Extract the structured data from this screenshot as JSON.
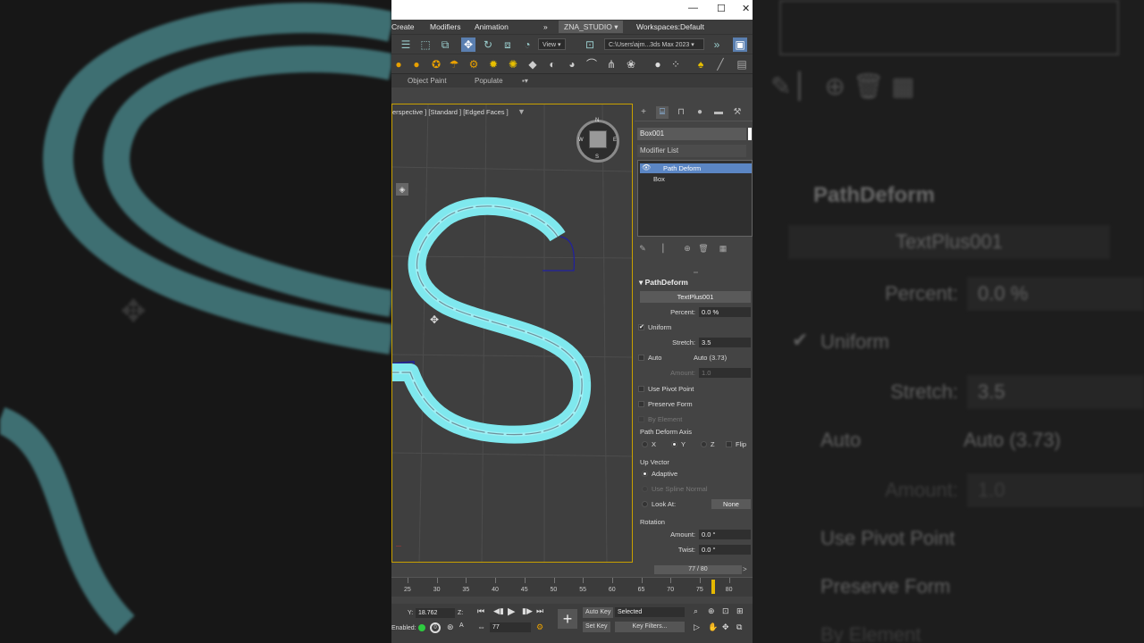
{
  "menubar": {
    "items": [
      "Create",
      "Modifiers",
      "Animation"
    ],
    "workspace_menu": "ZNA_STUDIO",
    "workspaces_label": "Workspaces:",
    "workspaces_value": "Default"
  },
  "toolbar": {
    "view_dropdown": "View",
    "path_dropdown": "C:\\Users\\ajm...3ds Max 2023"
  },
  "ribbon": {
    "tabs": [
      "Object Paint",
      "Populate"
    ]
  },
  "viewport": {
    "label": "erspective ] [Standard ] [Edged Faces ]",
    "compass": {
      "n": "N",
      "s": "S",
      "e": "E",
      "w": "W"
    }
  },
  "command_panel": {
    "object_name": "Box001",
    "modifier_list_label": "Modifier List",
    "stack": [
      "Path Deform",
      "Box"
    ],
    "rollout_title": "PathDeform",
    "path_button": "TextPlus001",
    "percent_label": "Percent:",
    "percent_value": "0.0 %",
    "uniform_label": "Uniform",
    "stretch_label": "Stretch:",
    "stretch_value": "3.5",
    "auto_label": "Auto",
    "auto_value": "Auto (3.73)",
    "amount_label": "Amount:",
    "amount_value": "1.0",
    "use_pivot_label": "Use Pivot Point",
    "preserve_form_label": "Preserve Form",
    "by_element_label": "By Element",
    "axis_section": "Path Deform Axis",
    "axis_x": "X",
    "axis_y": "Y",
    "axis_z": "Z",
    "flip_label": "Flip",
    "up_vector_section": "Up Vector",
    "adaptive_label": "Adaptive",
    "use_spline_normal_label": "Use Spline Normal",
    "look_at_label": "Look At:",
    "look_at_value": "None",
    "rotation_section": "Rotation",
    "rot_amount_label": "Amount:",
    "rot_amount_value": "0.0 °",
    "twist_label": "Twist:",
    "twist_value": "0.0 °"
  },
  "timeline": {
    "slider_text": "77 / 80",
    "ticks": [
      "25",
      "30",
      "35",
      "40",
      "45",
      "50",
      "55",
      "60",
      "65",
      "70",
      "75",
      "80"
    ]
  },
  "status": {
    "y_label": "Y:",
    "y_value": "18.762",
    "z_label": "Z:",
    "enabled_label": "Enabled:",
    "auto_key": "Auto Key",
    "set_key": "Set Key",
    "selected": "Selected",
    "key_filters": "Key Filters...",
    "frame": "77"
  },
  "right_panel": {
    "rollout_title": "PathDeform",
    "path_button": "TextPlus001",
    "percent_label": "Percent:",
    "percent_value": "0.0 %",
    "uniform_label": "Uniform",
    "stretch_label": "Stretch:",
    "stretch_value": "3.5",
    "auto_label": "Auto",
    "auto_value": "Auto (3.73)",
    "amount_label": "Amount:",
    "amount_value": "1.0",
    "use_pivot_label": "Use Pivot Point",
    "preserve_form_label": "Preserve Form",
    "by_element_label": "By Element"
  },
  "colors": {
    "selection_cyan": "#7fe8ee",
    "stack_highlight": "#5b86c4",
    "viewport_border": "#c8a000"
  }
}
